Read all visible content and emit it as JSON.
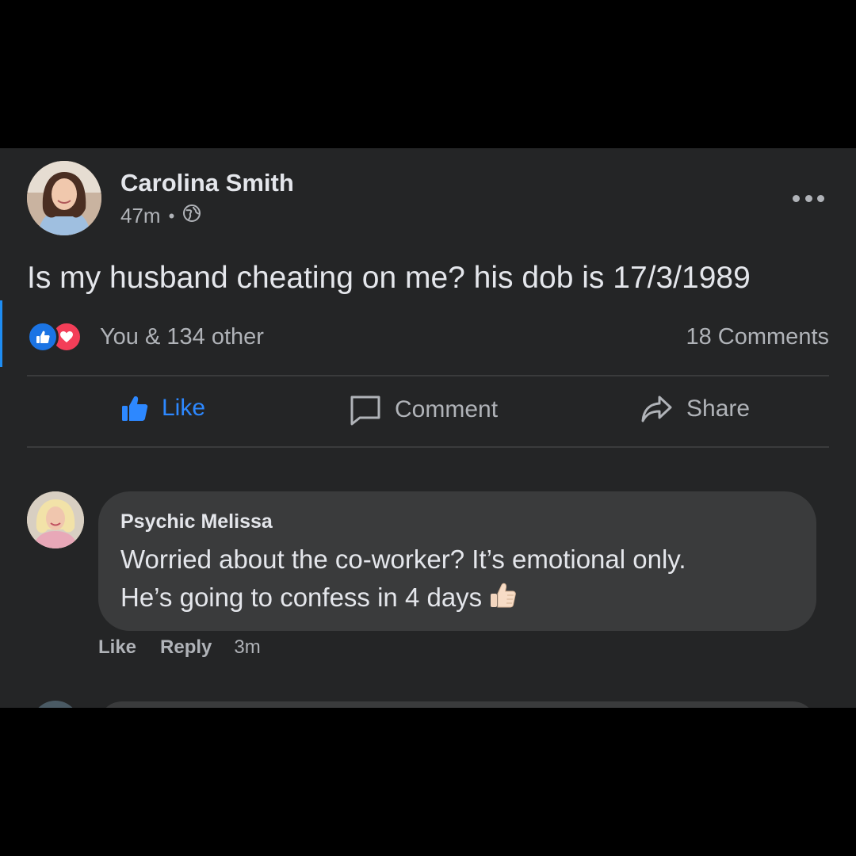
{
  "post": {
    "author_name": "Carolina Smith",
    "time": "47m",
    "separator": "•",
    "privacy_icon": "globe-icon",
    "more_icon": "more-horizontal-icon",
    "text": "Is my husband cheating on me? his dob is 17/3/1989",
    "reactions": {
      "icons": [
        "like-reaction-icon",
        "love-reaction-icon"
      ],
      "summary": "You & 134 other"
    },
    "comments_count": "18 Comments",
    "actions": {
      "like": "Like",
      "comment": "Comment",
      "share": "Share"
    }
  },
  "comments": [
    {
      "author": "Psychic Melissa",
      "text_line1": "Worried about the co-worker? It’s emotional only.",
      "text_line2": "He’s going to confess in 4 days",
      "emoji": "thumbs-up-emoji",
      "like_label": "Like",
      "reply_label": "Reply",
      "time": "3m"
    }
  ],
  "colors": {
    "background": "#242526",
    "bubble": "#3a3b3c",
    "primary_text": "#e4e6eb",
    "secondary_text": "#b0b3b8",
    "like_blue": "#2d88ff",
    "love_red": "#f33e58"
  }
}
